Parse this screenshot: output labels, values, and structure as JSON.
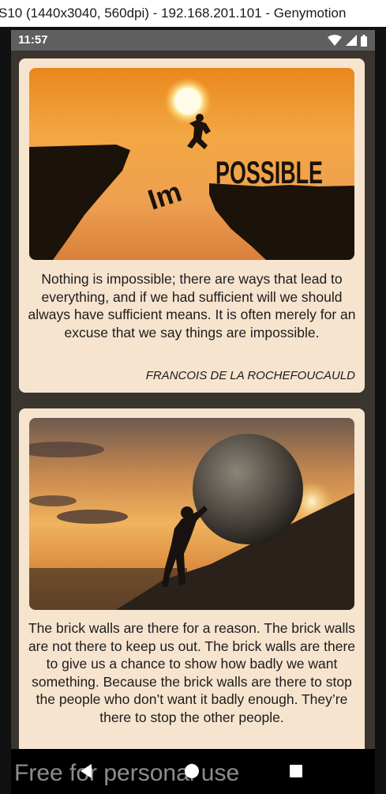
{
  "window": {
    "title": "S10 (1440x3040, 560dpi) - 192.168.201.101 - Genymotion"
  },
  "status_bar": {
    "time": "11:57",
    "icons": [
      "wifi-icon",
      "cellular-signal-icon",
      "battery-icon"
    ]
  },
  "quotes": [
    {
      "image": "jumping-gap-impossible-photo",
      "photo_text": "POSSIBLE",
      "photo_letters": "Im",
      "text": "Nothing is impossible; there are ways that lead to everything, and if we had sufficient will we should always have sufficient means. It is often merely for an excuse that we say things are impossible.",
      "author": "FRANCOIS DE LA ROCHEFOUCAULD"
    },
    {
      "image": "pushing-boulder-uphill-photo",
      "text": "The brick walls are there for a reason. The brick walls are not there to keep us out. The brick walls are there to give us a chance to show how badly we want something. Because the brick walls are there to stop the people who don’t want it badly enough. They’re there to stop the other people."
    }
  ],
  "nav_bar": {
    "buttons": [
      "back-icon",
      "home-icon",
      "recents-icon"
    ]
  },
  "watermark": "Free for personal use",
  "colors": {
    "card_background": "#f7e4cf",
    "screen_background": "#3a362f",
    "status_bar": "#5f5f5f"
  }
}
